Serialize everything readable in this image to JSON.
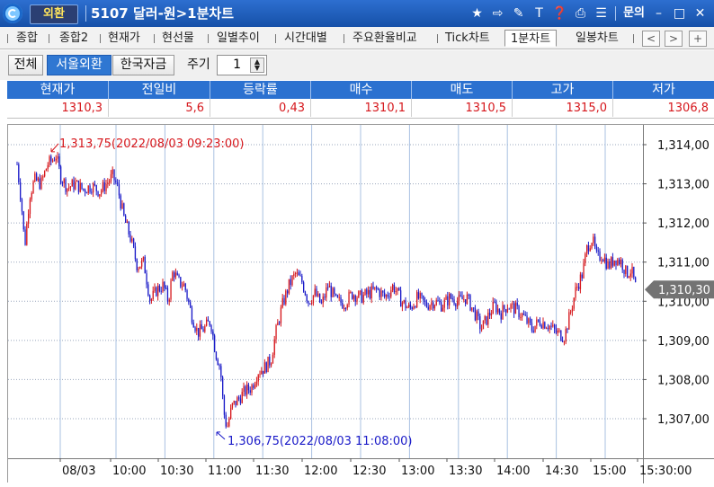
{
  "window": {
    "badge": "외환",
    "title": "5107 달러-원>1분차트",
    "inquiry_label": "문의",
    "icons": [
      "star-icon",
      "export-icon",
      "link-icon",
      "text-icon",
      "help-icon",
      "print-icon",
      "list-icon",
      "minimize-icon",
      "maximize-icon",
      "close-icon"
    ]
  },
  "tabs": [
    {
      "label": "종합",
      "active": false
    },
    {
      "label": "종합2",
      "active": false
    },
    {
      "label": "현재가",
      "active": false
    },
    {
      "label": "현선물",
      "active": false
    },
    {
      "label": "일별추이",
      "active": false
    },
    {
      "label": "시간대별",
      "active": false
    },
    {
      "label": "주요환율비교",
      "active": false
    },
    {
      "label": "Tick차트",
      "active": false
    },
    {
      "label": "1분차트",
      "active": true
    },
    {
      "label": "일봉차트",
      "active": false
    }
  ],
  "tab_nav": {
    "prev": "<",
    "next": ">",
    "add": "+"
  },
  "toolbar": {
    "filters": [
      {
        "label": "전체",
        "selected": false
      },
      {
        "label": "서울외환",
        "selected": true
      },
      {
        "label": "한국자금",
        "selected": false
      }
    ],
    "period_label": "주기",
    "period_value": "1"
  },
  "quote": {
    "headers": [
      "현재가",
      "전일비",
      "등락률",
      "매수",
      "매도",
      "고가",
      "저가"
    ],
    "values": [
      "1310,3",
      "5,6",
      "0,43",
      "1310,1",
      "1310,5",
      "1315,0",
      "1306,8"
    ]
  },
  "colors": {
    "up": "#d6171c",
    "down": "#1a1ac8",
    "header_bg": "#2b71d0",
    "title_bg": "#1f5fbf"
  },
  "chart_data": {
    "type": "candlestick",
    "interval": "1 minute",
    "date_label": "08/03",
    "x_ticks": [
      "08/03",
      "10:00",
      "10:30",
      "11:00",
      "11:30",
      "12:00",
      "12:30",
      "13:00",
      "13:30",
      "14:00",
      "14:30",
      "15:00",
      "15:30:00"
    ],
    "y_ticks": [
      "1,314,00",
      "1,313,00",
      "1,312,00",
      "1,311,00",
      "1,310,00",
      "1,309,00",
      "1,308,00",
      "1,307,00"
    ],
    "ylim": [
      1306.2,
      1314.3
    ],
    "current_price_label": "1,310,30",
    "current_price": 1310.3,
    "annotations": [
      {
        "text": "1,313,75(2022/08/03 09:23:00)",
        "time": "09:23",
        "value": 1313.75,
        "kind": "high"
      },
      {
        "text": "1,306,75(2022/08/03 11:08:00)",
        "time": "11:08",
        "value": 1306.75,
        "kind": "low"
      }
    ],
    "path": [
      [
        "09:00",
        1313.5
      ],
      [
        "09:02",
        1312.5
      ],
      [
        "09:04",
        1311.4
      ],
      [
        "09:07",
        1312.7
      ],
      [
        "09:10",
        1313.1
      ],
      [
        "09:14",
        1313.0
      ],
      [
        "09:18",
        1313.5
      ],
      [
        "09:21",
        1313.6
      ],
      [
        "09:23",
        1313.75
      ],
      [
        "09:26",
        1313.2
      ],
      [
        "09:30",
        1312.9
      ],
      [
        "09:35",
        1313.0
      ],
      [
        "09:40",
        1312.85
      ],
      [
        "09:45",
        1312.95
      ],
      [
        "09:50",
        1312.8
      ],
      [
        "09:55",
        1313.05
      ],
      [
        "09:58",
        1313.2
      ],
      [
        "10:01",
        1312.9
      ],
      [
        "10:05",
        1312.1
      ],
      [
        "10:09",
        1311.6
      ],
      [
        "10:13",
        1310.9
      ],
      [
        "10:17",
        1311.0
      ],
      [
        "10:21",
        1310.0
      ],
      [
        "10:25",
        1310.3
      ],
      [
        "10:29",
        1310.4
      ],
      [
        "10:32",
        1310.0
      ],
      [
        "10:35",
        1310.8
      ],
      [
        "10:38",
        1310.5
      ],
      [
        "10:42",
        1310.4
      ],
      [
        "10:46",
        1309.7
      ],
      [
        "10:50",
        1309.2
      ],
      [
        "10:54",
        1309.3
      ],
      [
        "10:58",
        1309.5
      ],
      [
        "11:01",
        1308.7
      ],
      [
        "11:04",
        1308.3
      ],
      [
        "11:06",
        1307.2
      ],
      [
        "11:08",
        1306.75
      ],
      [
        "11:11",
        1307.3
      ],
      [
        "11:15",
        1307.5
      ],
      [
        "11:19",
        1307.7
      ],
      [
        "11:23",
        1307.8
      ],
      [
        "11:27",
        1308.2
      ],
      [
        "11:31",
        1308.3
      ],
      [
        "11:35",
        1308.5
      ],
      [
        "11:38",
        1309.2
      ],
      [
        "11:42",
        1309.9
      ],
      [
        "11:46",
        1310.4
      ],
      [
        "11:50",
        1310.7
      ],
      [
        "11:54",
        1310.5
      ],
      [
        "11:58",
        1310.0
      ],
      [
        "12:02",
        1310.2
      ],
      [
        "12:06",
        1309.9
      ],
      [
        "12:10",
        1310.4
      ],
      [
        "12:15",
        1310.0
      ],
      [
        "12:20",
        1309.95
      ],
      [
        "12:25",
        1310.2
      ],
      [
        "12:30",
        1310.1
      ],
      [
        "12:35",
        1310.2
      ],
      [
        "12:40",
        1310.3
      ],
      [
        "12:45",
        1310.1
      ],
      [
        "12:50",
        1310.4
      ],
      [
        "12:55",
        1310.0
      ],
      [
        "13:00",
        1309.8
      ],
      [
        "13:05",
        1310.1
      ],
      [
        "13:10",
        1309.9
      ],
      [
        "13:15",
        1310.0
      ],
      [
        "13:20",
        1309.9
      ],
      [
        "13:25",
        1310.1
      ],
      [
        "13:30",
        1310.0
      ],
      [
        "13:35",
        1310.1
      ],
      [
        "13:40",
        1309.7
      ],
      [
        "13:44",
        1309.3
      ],
      [
        "13:48",
        1309.6
      ],
      [
        "13:52",
        1309.9
      ],
      [
        "13:56",
        1309.7
      ],
      [
        "14:00",
        1309.9
      ],
      [
        "14:05",
        1309.8
      ],
      [
        "14:10",
        1309.6
      ],
      [
        "14:15",
        1309.3
      ],
      [
        "14:20",
        1309.5
      ],
      [
        "14:25",
        1309.4
      ],
      [
        "14:30",
        1309.2
      ],
      [
        "14:35",
        1309.1
      ],
      [
        "14:38",
        1309.6
      ],
      [
        "14:42",
        1310.3
      ],
      [
        "14:46",
        1310.7
      ],
      [
        "14:49",
        1311.4
      ],
      [
        "14:52",
        1311.6
      ],
      [
        "14:55",
        1311.1
      ],
      [
        "14:58",
        1311.2
      ],
      [
        "15:02",
        1310.9
      ],
      [
        "15:06",
        1311.1
      ],
      [
        "15:10",
        1311.0
      ],
      [
        "15:13",
        1310.7
      ],
      [
        "15:16",
        1310.8
      ],
      [
        "15:19",
        1310.3
      ]
    ]
  }
}
